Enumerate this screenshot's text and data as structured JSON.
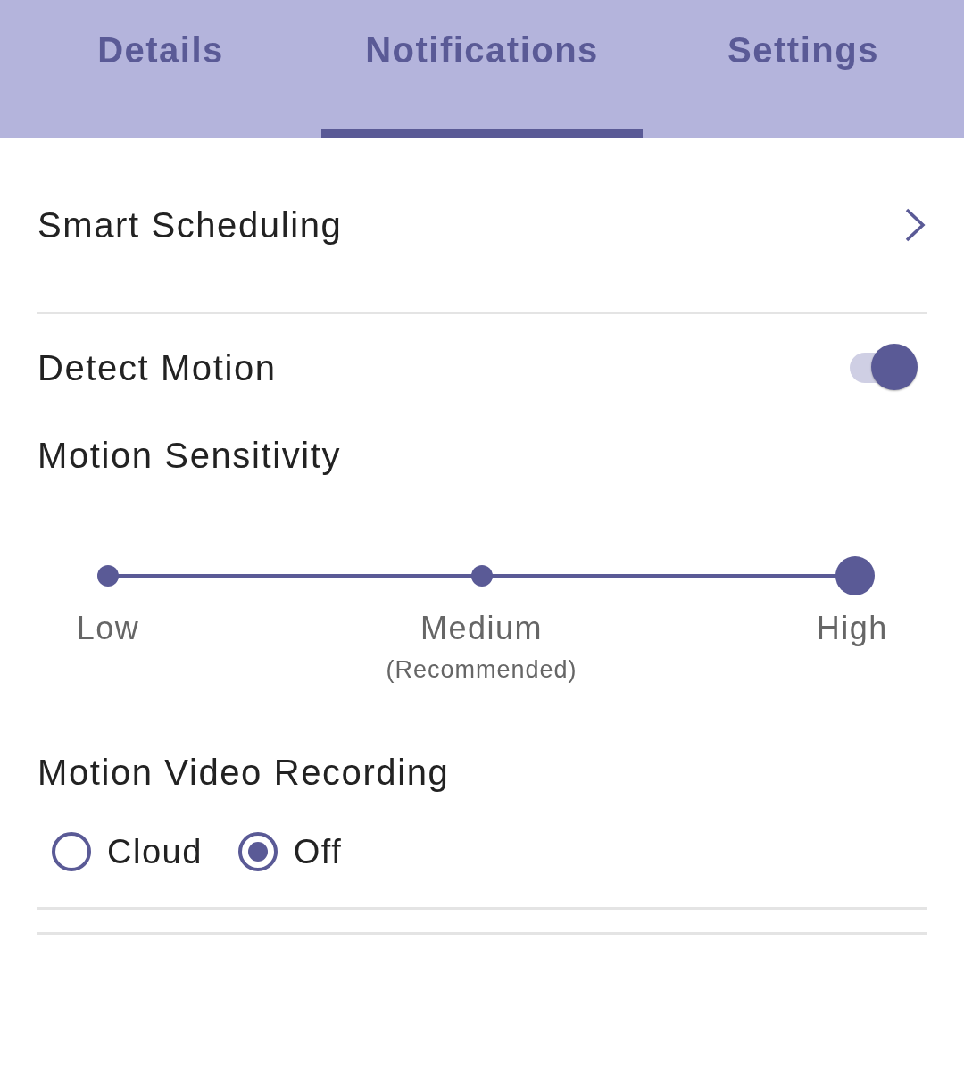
{
  "tabs": [
    {
      "label": "Details",
      "selected": false
    },
    {
      "label": "Notifications",
      "selected": true
    },
    {
      "label": "Settings",
      "selected": false
    }
  ],
  "smart_scheduling": {
    "label": "Smart Scheduling"
  },
  "detect_motion": {
    "label": "Detect Motion",
    "on": true
  },
  "motion_sensitivity": {
    "label": "Motion Sensitivity",
    "options": [
      {
        "label": "Low",
        "selected": false
      },
      {
        "label": "Medium",
        "note": "(Recommended)",
        "selected": false
      },
      {
        "label": "High",
        "selected": true
      }
    ]
  },
  "motion_video_recording": {
    "label": "Motion Video Recording",
    "options": [
      {
        "label": "Cloud",
        "selected": false
      },
      {
        "label": "Off",
        "selected": true
      }
    ]
  }
}
